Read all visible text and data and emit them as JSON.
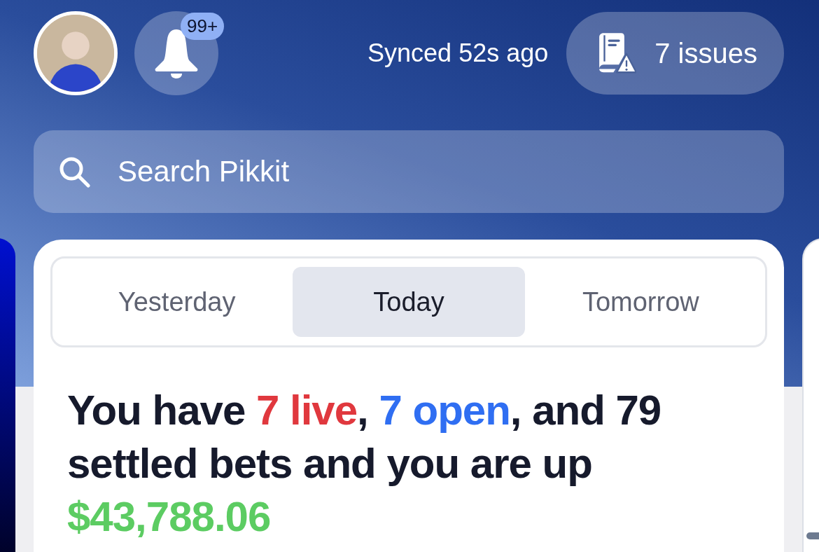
{
  "header": {
    "notifications": {
      "badge": "99+"
    },
    "sync_status": "Synced 52s ago",
    "issues_button": {
      "label": "7 issues"
    }
  },
  "search": {
    "placeholder": "Search Pikkit"
  },
  "day_tabs": [
    {
      "label": "Yesterday",
      "selected": false
    },
    {
      "label": "Today",
      "selected": true
    },
    {
      "label": "Tomorrow",
      "selected": false
    }
  ],
  "summary": [
    {
      "kind": "plain",
      "text": "You have "
    },
    {
      "kind": "live",
      "text": "7 live"
    },
    {
      "kind": "plain",
      "text": ", "
    },
    {
      "kind": "open",
      "text": "7 open"
    },
    {
      "kind": "plain",
      "text": ", and 79 settled bets and you are up "
    },
    {
      "kind": "profit",
      "text": "$43,788.06"
    }
  ]
}
